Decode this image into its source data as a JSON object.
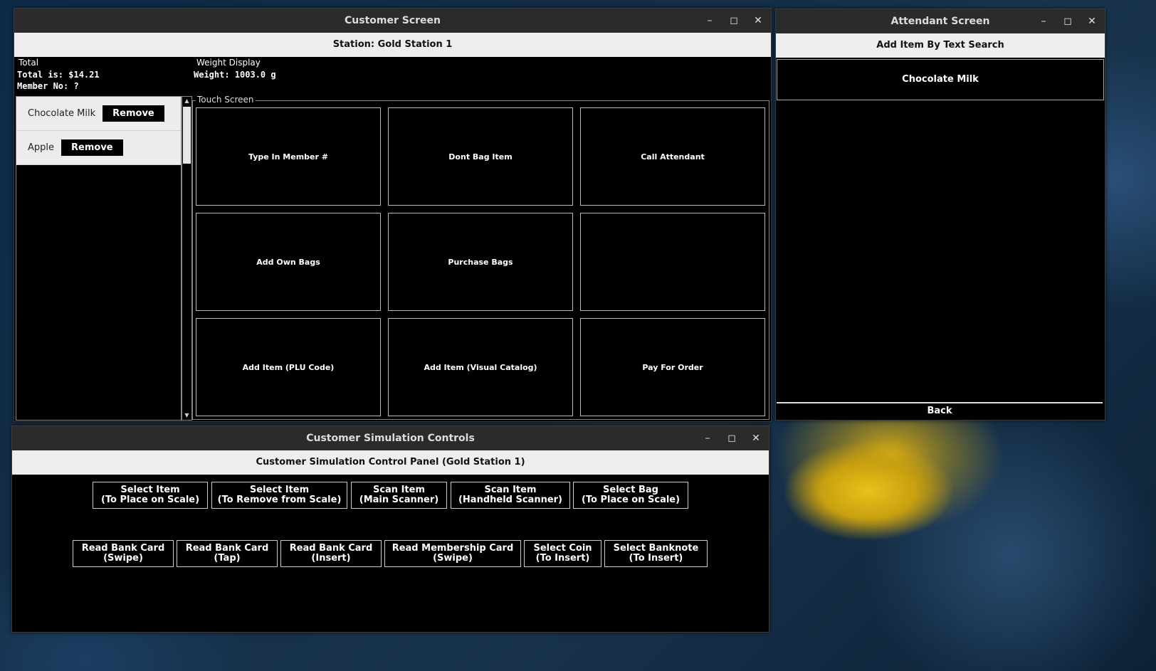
{
  "customer_window": {
    "title": "Customer Screen",
    "station": "Station: Gold Station 1",
    "total_heading": "Total",
    "total_text": "Total is: $14.21",
    "member_text": "Member No: ?",
    "weight_heading": "Weight Display",
    "weight_text": "Weight: 1003.0 g",
    "cart_items": [
      {
        "name": "Chocolate Milk",
        "remove_label": "Remove"
      },
      {
        "name": "Apple",
        "remove_label": "Remove"
      }
    ],
    "touch_screen_label": "Touch Screen",
    "touch_buttons": [
      "Type In Member #",
      "Dont Bag Item",
      "Call Attendant",
      "Add Own Bags",
      "Purchase Bags",
      "",
      "Add Item (PLU Code)",
      "Add Item (Visual Catalog)",
      "Pay For Order"
    ]
  },
  "attendant_window": {
    "title": "Attendant Screen",
    "header": "Add Item By Text Search",
    "result_item": "Chocolate Milk",
    "back_label": "Back"
  },
  "simulation_window": {
    "title": "Customer Simulation Controls",
    "header": "Customer Simulation Control Panel (Gold Station 1)",
    "row1": [
      {
        "line1": "Select Item",
        "line2": "(To Place on Scale)"
      },
      {
        "line1": "Select Item",
        "line2": "(To Remove from Scale)"
      },
      {
        "line1": "Scan Item",
        "line2": "(Main Scanner)"
      },
      {
        "line1": "Scan Item",
        "line2": "(Handheld Scanner)"
      },
      {
        "line1": "Select Bag",
        "line2": "(To Place on Scale)"
      }
    ],
    "row2": [
      {
        "line1": "Read Bank Card",
        "line2": "(Swipe)"
      },
      {
        "line1": "Read Bank Card",
        "line2": "(Tap)"
      },
      {
        "line1": "Read Bank Card",
        "line2": "(Insert)"
      },
      {
        "line1": "Read Membership Card",
        "line2": "(Swipe)"
      },
      {
        "line1": "Select Coin",
        "line2": "(To Insert)"
      },
      {
        "line1": "Select Banknote",
        "line2": "(To Insert)"
      }
    ]
  },
  "window_controls": {
    "minimize": "–",
    "maximize": "◻",
    "close": "✕"
  }
}
